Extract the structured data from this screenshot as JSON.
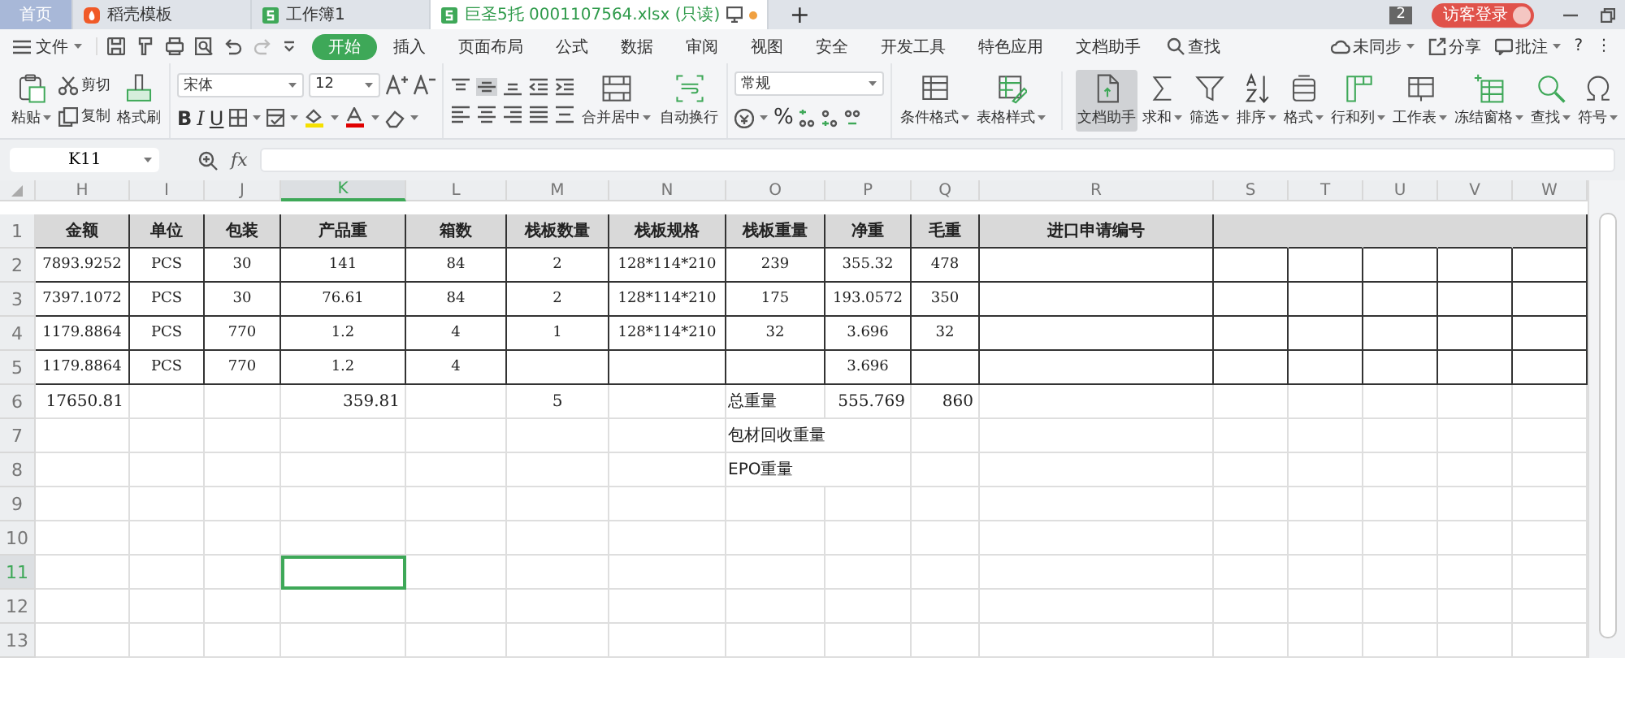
{
  "tabs": [
    {
      "label": "首页",
      "kind": "home",
      "selected": false,
      "modified": false
    },
    {
      "label": "稻壳模板",
      "kind": "template",
      "selected": false,
      "modified": false
    },
    {
      "label": "工作簿1",
      "kind": "sheet",
      "selected": false,
      "modified": false
    },
    {
      "label": "巨圣5托 0001107564.xlsx (只读)",
      "kind": "sheet",
      "selected": true,
      "modified": true
    }
  ],
  "new_tab": "+",
  "window_badge": "2",
  "login_button": "访客登录",
  "file_menu": "文件",
  "menu_tabs": [
    {
      "label": "开始",
      "selected": true
    },
    {
      "label": "插入",
      "selected": false
    },
    {
      "label": "页面布局",
      "selected": false
    },
    {
      "label": "公式",
      "selected": false
    },
    {
      "label": "数据",
      "selected": false
    },
    {
      "label": "审阅",
      "selected": false
    },
    {
      "label": "视图",
      "selected": false
    },
    {
      "label": "安全",
      "selected": false
    },
    {
      "label": "开发工具",
      "selected": false
    },
    {
      "label": "特色应用",
      "selected": false
    },
    {
      "label": "文档助手",
      "selected": false
    }
  ],
  "search_menu": "查找",
  "menu_right": {
    "sync": "未同步",
    "share": "分享",
    "comment": "批注",
    "help": "?",
    "more": "⋮"
  },
  "clipboard": {
    "paste": "粘贴",
    "cut": "剪切",
    "copy": "复制",
    "format_painter": "格式刷"
  },
  "font": {
    "name": "宋体",
    "size": "12",
    "bold": "B",
    "italic": "I",
    "underline": "U"
  },
  "alignment": {
    "merge": "合并居中",
    "wrap": "自动换行"
  },
  "number": {
    "format": "常规",
    "percent": "%"
  },
  "tools": [
    {
      "label": "条件格式",
      "dropdown": true,
      "selected": false
    },
    {
      "label": "表格样式",
      "dropdown": true,
      "selected": false
    },
    {
      "label": "文档助手",
      "dropdown": false,
      "selected": true
    },
    {
      "label": "求和",
      "dropdown": true,
      "selected": false
    },
    {
      "label": "筛选",
      "dropdown": true,
      "selected": false
    },
    {
      "label": "排序",
      "dropdown": true,
      "selected": false
    },
    {
      "label": "格式",
      "dropdown": true,
      "selected": false
    },
    {
      "label": "行和列",
      "dropdown": true,
      "selected": false
    },
    {
      "label": "工作表",
      "dropdown": true,
      "selected": false
    },
    {
      "label": "冻结窗格",
      "dropdown": true,
      "selected": false
    },
    {
      "label": "查找",
      "dropdown": true,
      "selected": false
    },
    {
      "label": "符号",
      "dropdown": true,
      "selected": false
    }
  ],
  "formula_bar": {
    "cell_name": "K11",
    "fx": "fx"
  },
  "columns": [
    {
      "label": "H",
      "selected": false
    },
    {
      "label": "I",
      "selected": false
    },
    {
      "label": "J",
      "selected": false
    },
    {
      "label": "K",
      "selected": true
    },
    {
      "label": "L",
      "selected": false
    },
    {
      "label": "M",
      "selected": false
    },
    {
      "label": "N",
      "selected": false
    },
    {
      "label": "O",
      "selected": false
    },
    {
      "label": "P",
      "selected": false
    },
    {
      "label": "Q",
      "selected": false
    },
    {
      "label": "R",
      "selected": false
    },
    {
      "label": "S",
      "selected": false
    },
    {
      "label": "T",
      "selected": false
    },
    {
      "label": "U",
      "selected": false
    },
    {
      "label": "V",
      "selected": false
    },
    {
      "label": "W",
      "selected": false
    }
  ],
  "rows": [
    {
      "label": "1",
      "kind": "header",
      "selected": false,
      "cells": [
        "金额",
        "单位",
        "包装",
        "产品重",
        "箱数",
        "栈板数量",
        "栈板规格",
        "栈板重量",
        "净重",
        "毛重",
        "进口申请编号"
      ]
    },
    {
      "label": "2",
      "kind": "data",
      "selected": false,
      "cells": [
        "7893.9252",
        "PCS",
        "30",
        "141",
        "84",
        "2",
        "128*114*210",
        "239",
        "355.32",
        "478"
      ]
    },
    {
      "label": "3",
      "kind": "data",
      "selected": false,
      "cells": [
        "7397.1072",
        "PCS",
        "30",
        "76.61",
        "84",
        "2",
        "128*114*210",
        "175",
        "193.0572",
        "350"
      ]
    },
    {
      "label": "4",
      "kind": "data",
      "selected": false,
      "cells": [
        "1179.8864",
        "PCS",
        "770",
        "1.2",
        "4",
        "1",
        "128*114*210",
        "32",
        "3.696",
        "32"
      ]
    },
    {
      "label": "5",
      "kind": "data",
      "selected": false,
      "cells": [
        "1179.8864",
        "PCS",
        "770",
        "1.2",
        "4",
        null,
        null,
        null,
        "3.696"
      ]
    },
    {
      "label": "6",
      "kind": "plain",
      "selected": false,
      "cells": [
        "17650.81",
        null,
        null,
        "359.81",
        null,
        "5",
        null,
        "总重量",
        "555.769",
        "860"
      ]
    },
    {
      "label": "7",
      "kind": "plain",
      "selected": false,
      "cells": [
        null,
        null,
        null,
        null,
        null,
        null,
        null,
        "包材回收重量"
      ]
    },
    {
      "label": "8",
      "kind": "plain",
      "selected": false,
      "cells": [
        null,
        null,
        null,
        null,
        null,
        null,
        null,
        "EPO重量"
      ]
    },
    {
      "label": "9",
      "kind": "plain",
      "selected": false,
      "cells": []
    },
    {
      "label": "10",
      "kind": "plain",
      "selected": false,
      "cells": []
    },
    {
      "label": "11",
      "kind": "plain",
      "selected": true,
      "cells": []
    },
    {
      "label": "12",
      "kind": "plain",
      "selected": false,
      "cells": []
    },
    {
      "label": "13",
      "kind": "plain",
      "selected": false,
      "cells": []
    }
  ]
}
